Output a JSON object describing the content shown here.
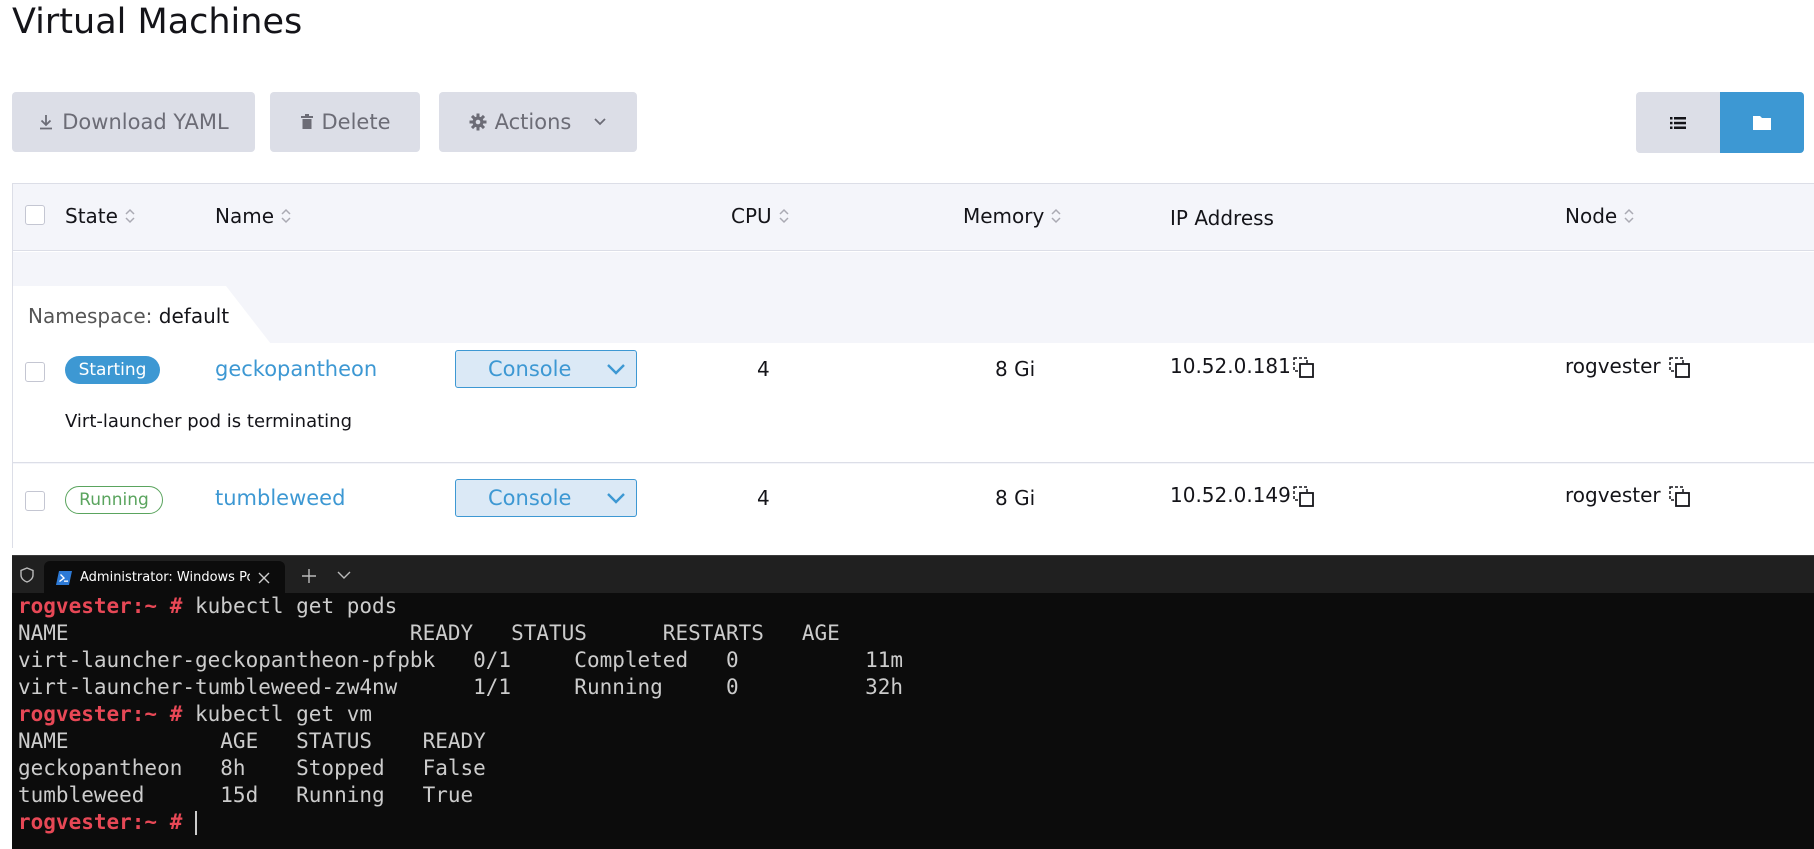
{
  "page": {
    "title": "Virtual Machines"
  },
  "toolbar": {
    "download_label": "Download YAML",
    "delete_label": "Delete",
    "actions_label": "Actions"
  },
  "view_toggle": {
    "active": "folder"
  },
  "table": {
    "columns": {
      "state": "State",
      "name": "Name",
      "cpu": "CPU",
      "memory": "Memory",
      "ip": "IP Address",
      "node": "Node"
    },
    "group": {
      "prefix": "Namespace:",
      "value": "default"
    },
    "rows": [
      {
        "state": "Starting",
        "name": "geckopantheon",
        "console": "Console",
        "cpu": "4",
        "memory": "8 Gi",
        "ip": "10.52.0.181",
        "node": "rogvester",
        "message": "Virt-launcher pod is terminating"
      },
      {
        "state": "Running",
        "name": "tumbleweed",
        "console": "Console",
        "cpu": "4",
        "memory": "8 Gi",
        "ip": "10.52.0.149",
        "node": "rogvester"
      }
    ],
    "colors": {
      "accent": "#3d98d3",
      "running": "#5aa45e"
    }
  },
  "terminal": {
    "tab_title": "Administrator: Windows PowerS",
    "prompt": "rogvester:~ #",
    "lines": [
      {
        "prompt": "rogvester:~ #",
        "text": " kubectl get pods"
      },
      {
        "text": "NAME                           READY   STATUS      RESTARTS   AGE"
      },
      {
        "text": "virt-launcher-geckopantheon-pfpbk   0/1     Completed   0          11m"
      },
      {
        "text": "virt-launcher-tumbleweed-zw4nw      1/1     Running     0          32h"
      },
      {
        "prompt": "rogvester:~ #",
        "text": " kubectl get vm"
      },
      {
        "text": "NAME            AGE   STATUS    READY"
      },
      {
        "text": "geckopantheon   8h    Stopped   False"
      },
      {
        "text": "tumbleweed      15d   Running   True"
      },
      {
        "prompt": "rogvester:~ #",
        "text": " "
      }
    ],
    "colors": {
      "prompt": "#e74856",
      "text": "#cccccc",
      "background": "#0c0c0c"
    }
  }
}
